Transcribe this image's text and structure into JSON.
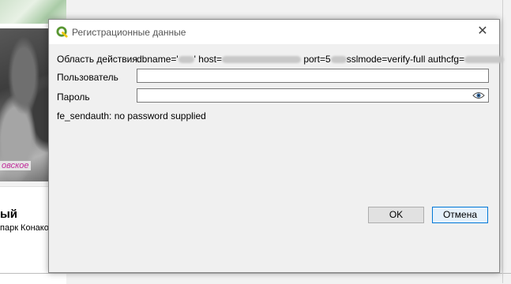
{
  "background": {
    "map_place_label": "овское",
    "card_title": "ый",
    "card_subtitle": "парк Конако"
  },
  "dialog": {
    "title": "Регистрационные данные",
    "close_glyph": "✕",
    "scope_label": "Область действия",
    "scope_parts": {
      "p1": "dbname='",
      "p2": "' host=",
      "p3": " port=5",
      "p4": "sslmode=verify-full authcfg="
    },
    "user_label": "Пользователь",
    "user_value": "",
    "password_label": "Пароль",
    "password_value": "",
    "error_message": "fe_sendauth: no password supplied",
    "ok_label": "OK",
    "cancel_label": "Отмена"
  },
  "colors": {
    "qgis_green": "#589632",
    "qgis_yellow": "#eec90d",
    "focus_blue": "#0078d7",
    "map_label": "#c02b9a"
  },
  "icons": {
    "title": "qgis-logo-icon",
    "close": "close-icon",
    "password_toggle": "eye-icon"
  }
}
